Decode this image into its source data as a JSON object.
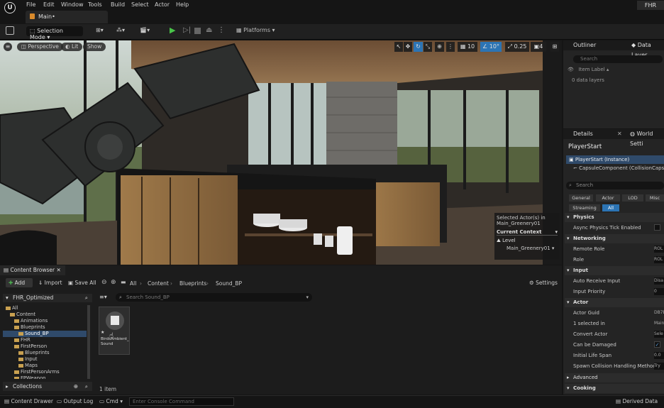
{
  "app": {
    "logo": "U",
    "brand": "FHR"
  },
  "menu": [
    "File",
    "Edit",
    "Window",
    "Tools",
    "Build",
    "Select",
    "Actor",
    "Help"
  ],
  "tab": {
    "label": "Main•"
  },
  "toolbar": {
    "selection_mode": "Selection Mode",
    "platforms": "Platforms"
  },
  "viewport": {
    "perspective": "Perspective",
    "lit": "Lit",
    "show": "Show",
    "grid_value": "10",
    "angle_value": "10°",
    "scale_value": "0.25",
    "camera_speed": "4",
    "selected_actor_label": "Selected Actor(s) in",
    "selected_actor_level": "Main_Greenery01",
    "current_context": "Current Context",
    "level_label": "Level",
    "level_value": "Main_Greenery01"
  },
  "outliner": {
    "tab": "Outliner",
    "tab2": "Data Layer",
    "search_placeholder": "Search",
    "column": "Item Label",
    "count": "0 data layers"
  },
  "details": {
    "tab": "Details",
    "tab2": "World Setti",
    "actor_name": "PlayerStart",
    "instance": "PlayerStart (Instance)",
    "component": "CapsuleComponent (CollisionCaps",
    "search_placeholder": "Search",
    "filters": [
      "General",
      "Actor",
      "LOD",
      "Misc",
      "Streaming",
      "All"
    ],
    "sections": {
      "physics": "Physics",
      "networking": "Networking",
      "input": "Input",
      "actor": "Actor",
      "advanced": "Advanced",
      "cooking": "Cooking"
    },
    "rows": {
      "async": "Async Physics Tick Enabled",
      "remote_role": "Remote Role",
      "remote_role_val": "ROL",
      "role": "Role",
      "role_val": "ROL",
      "auto_receive": "Auto Receive Input",
      "auto_receive_val": "Disa",
      "input_priority": "Input Priority",
      "input_priority_val": "0",
      "actor_guid": "Actor Guid",
      "actor_guid_val": "DB7B",
      "selected": "1 selected in",
      "selected_val": "Main_",
      "convert_actor": "Convert Actor",
      "convert_actor_val": "Sele",
      "can_be_damaged": "Can be Damaged",
      "initial_life_span": "Initial Life Span",
      "initial_life_span_val": "0.0",
      "spawn_collision": "Spawn Collision Handling Method",
      "spawn_collision_val": "Try"
    }
  },
  "content_browser": {
    "tab": "Content Browser",
    "add": "Add",
    "import": "Import",
    "save_all": "Save All",
    "path": [
      "All",
      "Content",
      "Blueprints",
      "Sound_BP"
    ],
    "settings": "Settings",
    "project": "FHR_Optimized",
    "search_placeholder": "Search Sound_BP",
    "tree": [
      {
        "label": "All",
        "indent": 0
      },
      {
        "label": "Content",
        "indent": 1
      },
      {
        "label": "Animations",
        "indent": 2
      },
      {
        "label": "Blueprints",
        "indent": 2
      },
      {
        "label": "Sound_BP",
        "indent": 3
      },
      {
        "label": "FHR",
        "indent": 2
      },
      {
        "label": "FirstPerson",
        "indent": 2
      },
      {
        "label": "Blueprints",
        "indent": 3
      },
      {
        "label": "Input",
        "indent": 3
      },
      {
        "label": "Maps",
        "indent": 3
      },
      {
        "label": "FirstPersonArms",
        "indent": 2
      },
      {
        "label": "FPWeapon",
        "indent": 2
      }
    ],
    "collections": "Collections",
    "asset_name": "BirdsAmbient_Sound",
    "item_count": "1 item"
  },
  "status": {
    "content_drawer": "Content Drawer",
    "output_log": "Output Log",
    "cmd": "Cmd",
    "console_placeholder": "Enter Console Command",
    "derived_data": "Derived Data"
  }
}
